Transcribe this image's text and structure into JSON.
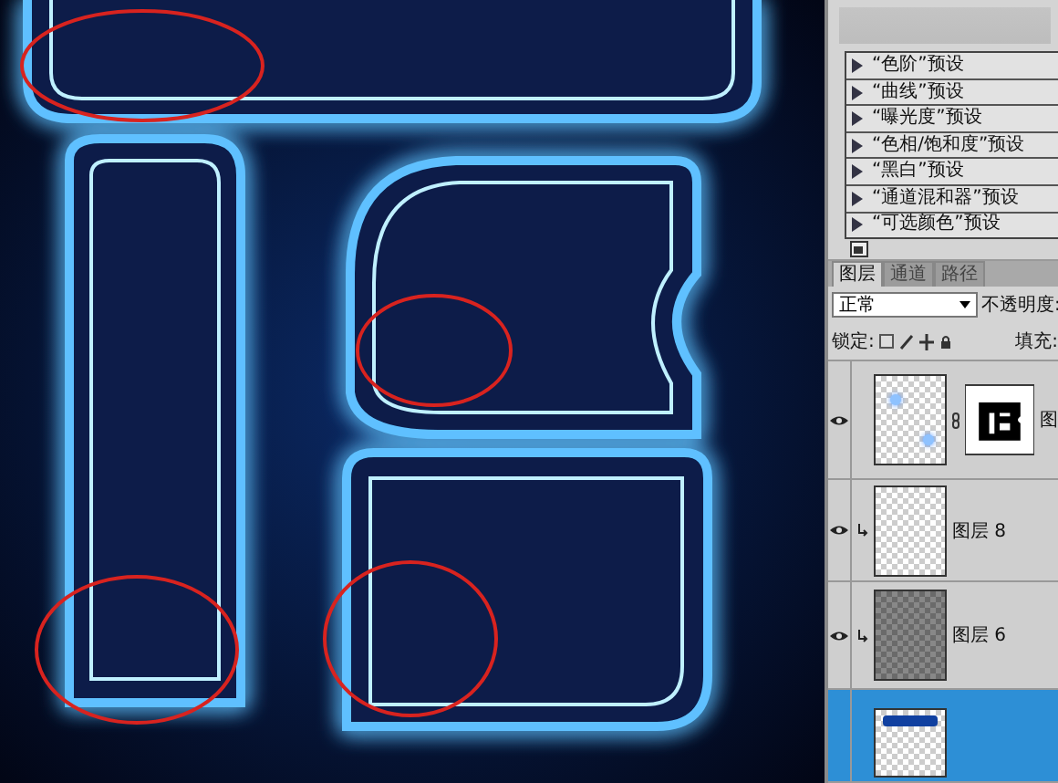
{
  "presets": [
    {
      "label": "“色阶”预设"
    },
    {
      "label": "“曲线”预设"
    },
    {
      "label": "“曝光度”预设"
    },
    {
      "label": "“色相/饱和度”预设"
    },
    {
      "label": "“黑白”预设"
    },
    {
      "label": "“通道混和器”预设"
    },
    {
      "label": "“可选颜色”预设"
    }
  ],
  "layer_tabs": [
    {
      "label": "图层",
      "selected": true
    },
    {
      "label": "通道",
      "selected": false
    },
    {
      "label": "路径",
      "selected": false
    }
  ],
  "blend_mode": "正常",
  "opacity_label": "不透明度:",
  "lock_label": "锁定:",
  "fill_label": "填充:",
  "layers": [
    {
      "kind": "masked",
      "name": "图",
      "visible": true,
      "clipped": false,
      "selected": false
    },
    {
      "kind": "transparent",
      "name": "图层 8",
      "visible": true,
      "clipped": true,
      "selected": false
    },
    {
      "kind": "pattern",
      "name": "图层 6",
      "visible": true,
      "clipped": true,
      "selected": false
    },
    {
      "kind": "shape",
      "visible": false,
      "clipped": false,
      "selected": true
    }
  ]
}
